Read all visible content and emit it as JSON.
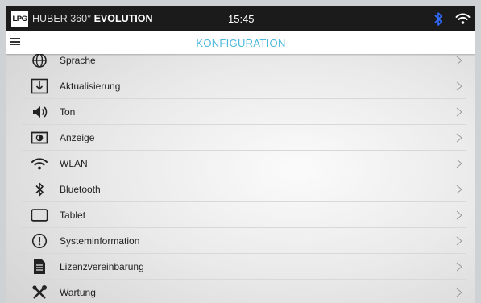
{
  "status_bar": {
    "logo_text": "LPG",
    "brand_thin": "HUBER 360°",
    "brand_bold": "EVOLUTION",
    "time": "15:45",
    "icons": [
      "bluetooth-icon",
      "wifi-icon"
    ],
    "bluetooth_color": "#2f6bff"
  },
  "title_bar": {
    "menu_icon": "hamburger-menu-icon",
    "title": "KONFIGURATION",
    "title_color": "#4bb8dd"
  },
  "settings": {
    "items": [
      {
        "label": "Sprache",
        "icon": "globe-icon"
      },
      {
        "label": "Aktualisierung",
        "icon": "download-icon"
      },
      {
        "label": "Ton",
        "icon": "speaker-icon"
      },
      {
        "label": "Anzeige",
        "icon": "display-icon"
      },
      {
        "label": "WLAN",
        "icon": "wifi-icon"
      },
      {
        "label": "Bluetooth",
        "icon": "bluetooth-icon"
      },
      {
        "label": "Tablet",
        "icon": "tablet-icon"
      },
      {
        "label": "Systeminformation",
        "icon": "info-icon"
      },
      {
        "label": "Lizenzvereinbarung",
        "icon": "document-icon"
      },
      {
        "label": "Wartung",
        "icon": "tools-icon"
      }
    ]
  }
}
